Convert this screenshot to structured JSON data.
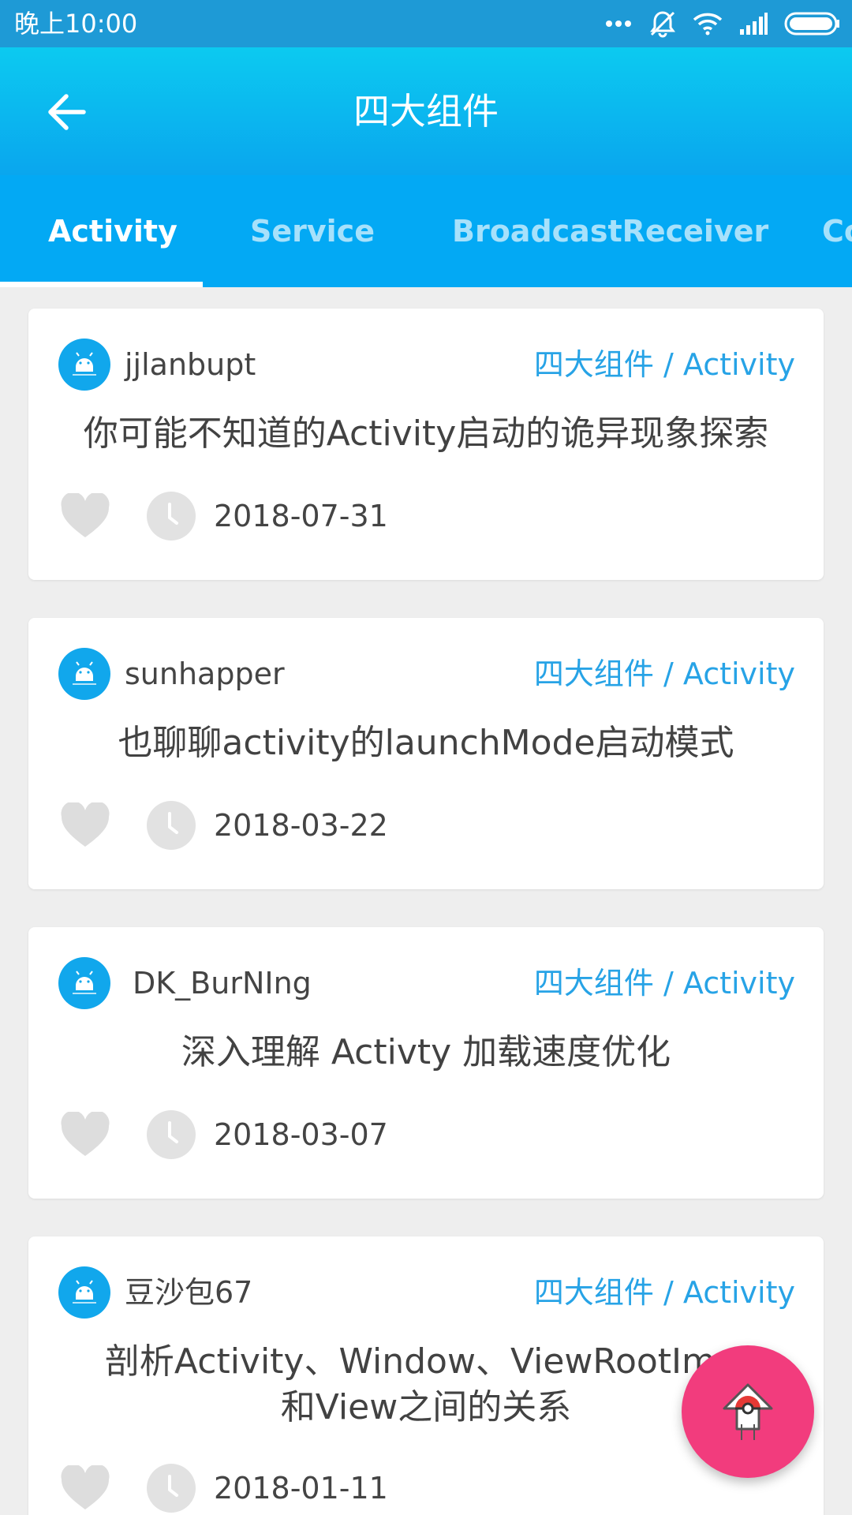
{
  "status_bar": {
    "time": "晚上10:00",
    "icons": [
      "more-dots-icon",
      "mute-icon",
      "wifi-icon",
      "signal-icon",
      "battery-icon"
    ]
  },
  "toolbar": {
    "title": "四大组件",
    "back_icon": "arrow-back-icon"
  },
  "tabs": [
    {
      "label": "Activity",
      "active": true
    },
    {
      "label": "Service",
      "active": false
    },
    {
      "label": "BroadcastReceiver",
      "active": false
    },
    {
      "label": "Co",
      "active": false
    }
  ],
  "articles": [
    {
      "author": "jjlanbupt",
      "category": "四大组件 / Activity",
      "title": "你可能不知道的Activity启动的诡异现象探索",
      "date": "2018-07-31"
    },
    {
      "author": "sunhapper",
      "category": "四大组件 / Activity",
      "title": "也聊聊activity的launchMode启动模式",
      "date": "2018-03-22"
    },
    {
      "author": "DK_BurNIng",
      "category": "四大组件 / Activity",
      "title": "深入理解 Activty 加载速度优化",
      "date": "2018-03-07"
    },
    {
      "author": "豆沙包67",
      "category": "四大组件 / Activity",
      "title": "剖析Activity、Window、ViewRootImpl和View之间的关系",
      "date": "2018-01-11"
    }
  ],
  "fab": {
    "icon": "scroll-to-top-icon"
  },
  "colors": {
    "status_bar": "#1e9ad6",
    "toolbar": "#0aa6ee",
    "tab_bar": "#03a9f4",
    "category": "#27a3e6",
    "fab": "#f23c7d"
  }
}
